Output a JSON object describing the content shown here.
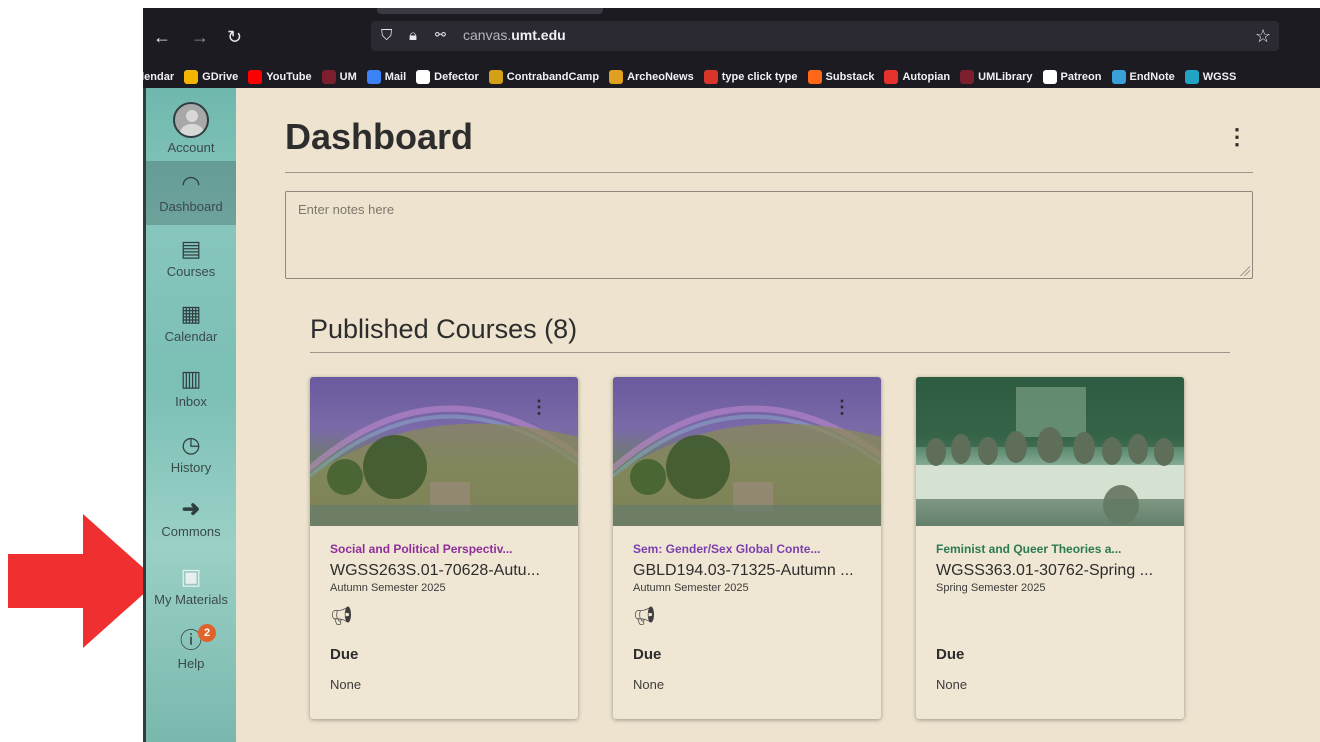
{
  "browser": {
    "url_prefix": "canvas.",
    "url_domain": "umt.edu",
    "bookmarks": [
      {
        "label": "alendar",
        "color": "#1c1b22"
      },
      {
        "label": "GDrive",
        "color": "#f4b400"
      },
      {
        "label": "YouTube",
        "color": "#ff0000"
      },
      {
        "label": "UM",
        "color": "#7a1f2b"
      },
      {
        "label": "Mail",
        "color": "#3b82f6"
      },
      {
        "label": "Defector",
        "color": "#ffffff"
      },
      {
        "label": "ContrabandCamp",
        "color": "#d4a017"
      },
      {
        "label": "ArcheoNews",
        "color": "#e0a020"
      },
      {
        "label": "type click type",
        "color": "#d9352a"
      },
      {
        "label": "Substack",
        "color": "#ff6719"
      },
      {
        "label": "Autopian",
        "color": "#e5322d"
      },
      {
        "label": "UMLibrary",
        "color": "#7a1f2b"
      },
      {
        "label": "Patreon",
        "color": "#ffffff"
      },
      {
        "label": "EndNote",
        "color": "#3aa0d8"
      },
      {
        "label": "WGSS",
        "color": "#21a3c4"
      }
    ]
  },
  "sidebar": {
    "items": [
      {
        "label": "Account",
        "icon": "avatar"
      },
      {
        "label": "Dashboard",
        "icon": "speedometer-icon"
      },
      {
        "label": "Courses",
        "icon": "book-icon"
      },
      {
        "label": "Calendar",
        "icon": "calendar-icon"
      },
      {
        "label": "Inbox",
        "icon": "inbox-icon"
      },
      {
        "label": "History",
        "icon": "clock-icon"
      },
      {
        "label": "Commons",
        "icon": "commons-icon"
      },
      {
        "label": "My Materials",
        "icon": "materials-icon"
      },
      {
        "label": "Help",
        "icon": "help-icon",
        "badge": "2"
      }
    ]
  },
  "main": {
    "title": "Dashboard",
    "notes_placeholder": "Enter notes here",
    "published_title": "Published Courses (8)",
    "cards": [
      {
        "name": "Social and Political Perspectiv...",
        "code": "WGSS263S.01-70628-Autu...",
        "term": "Autumn Semester 2025",
        "due_label": "Due",
        "due_value": "None",
        "color": "#8e2f9a"
      },
      {
        "name": "Sem: Gender/Sex Global Conte...",
        "code": "GBLD194.03-71325-Autumn ...",
        "term": "Autumn Semester 2025",
        "due_label": "Due",
        "due_value": "None",
        "color": "#7b3fb0"
      },
      {
        "name": "Feminist and Queer Theories a...",
        "code": "WGSS363.01-30762-Spring ...",
        "term": "Spring Semester 2025",
        "due_label": "Due",
        "due_value": "None",
        "color": "#2a7a53"
      }
    ]
  },
  "overlay": {
    "arrow_color": "#f03030"
  }
}
